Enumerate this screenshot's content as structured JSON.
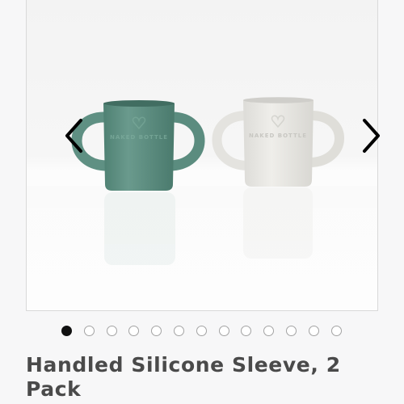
{
  "product": {
    "title": "Handled Silicone Sleeve, 2 Pack"
  },
  "image": {
    "alt": "Two handled silicone cups, one sage green and one light grey",
    "brand_emboss": "NAKED BOTTLE"
  },
  "carousel": {
    "slide_count": 13,
    "active_index": 0,
    "prev_icon": "chevron-left-icon",
    "next_icon": "chevron-right-icon"
  },
  "colors": {
    "title_text": "#4a4a4a",
    "dot_active": "#111111",
    "dot_inactive_border": "#a3a3a3",
    "cup_green": "#5b8d80",
    "cup_grey": "#e9e8e4"
  }
}
